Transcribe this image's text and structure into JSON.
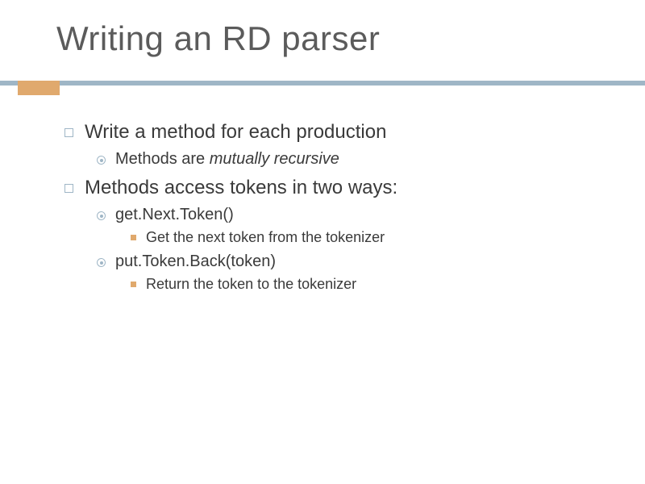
{
  "title": "Writing an RD parser",
  "items": [
    {
      "text": "Write a method for each production",
      "sub": [
        {
          "prefix": "Methods are ",
          "em": "mutually recursive"
        }
      ]
    },
    {
      "text": "Methods access tokens in two ways:",
      "sub": [
        {
          "text": "get.Next.Token()",
          "sub": [
            {
              "text": "Get the next token from the tokenizer"
            }
          ]
        },
        {
          "text": "put.Token.Back(token)",
          "sub": [
            {
              "text": "Return the token to the tokenizer"
            }
          ]
        }
      ]
    }
  ]
}
